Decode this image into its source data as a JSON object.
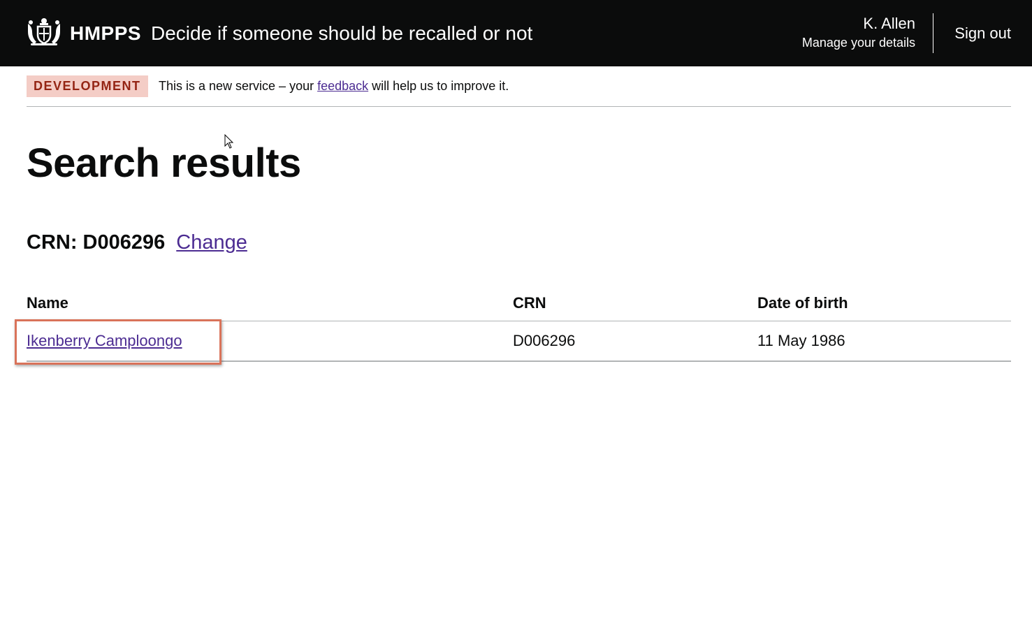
{
  "header": {
    "org": "HMPPS",
    "service_name": "Decide if someone should be recalled or not",
    "user_name": "K. Allen",
    "manage_details": "Manage your details",
    "sign_out": "Sign out",
    "crest_icon": "royal-crest-icon"
  },
  "phase_banner": {
    "tag": "DEVELOPMENT",
    "text_before": "This is a new service – your ",
    "link": "feedback",
    "text_after": " will help us to improve it."
  },
  "page": {
    "title": "Search results",
    "crn_label": "CRN: D006296",
    "change_link": "Change"
  },
  "table": {
    "headers": {
      "name": "Name",
      "crn": "CRN",
      "dob": "Date of birth"
    },
    "rows": [
      {
        "name": "Ikenberry Camploongo",
        "crn": "D006296",
        "dob": "11 May 1986"
      }
    ]
  },
  "colors": {
    "header_bg": "#0b0c0c",
    "link": "#4c2c92",
    "tag_bg": "#f4cdc6",
    "tag_text": "#942514",
    "highlight_border": "#d9735a"
  }
}
